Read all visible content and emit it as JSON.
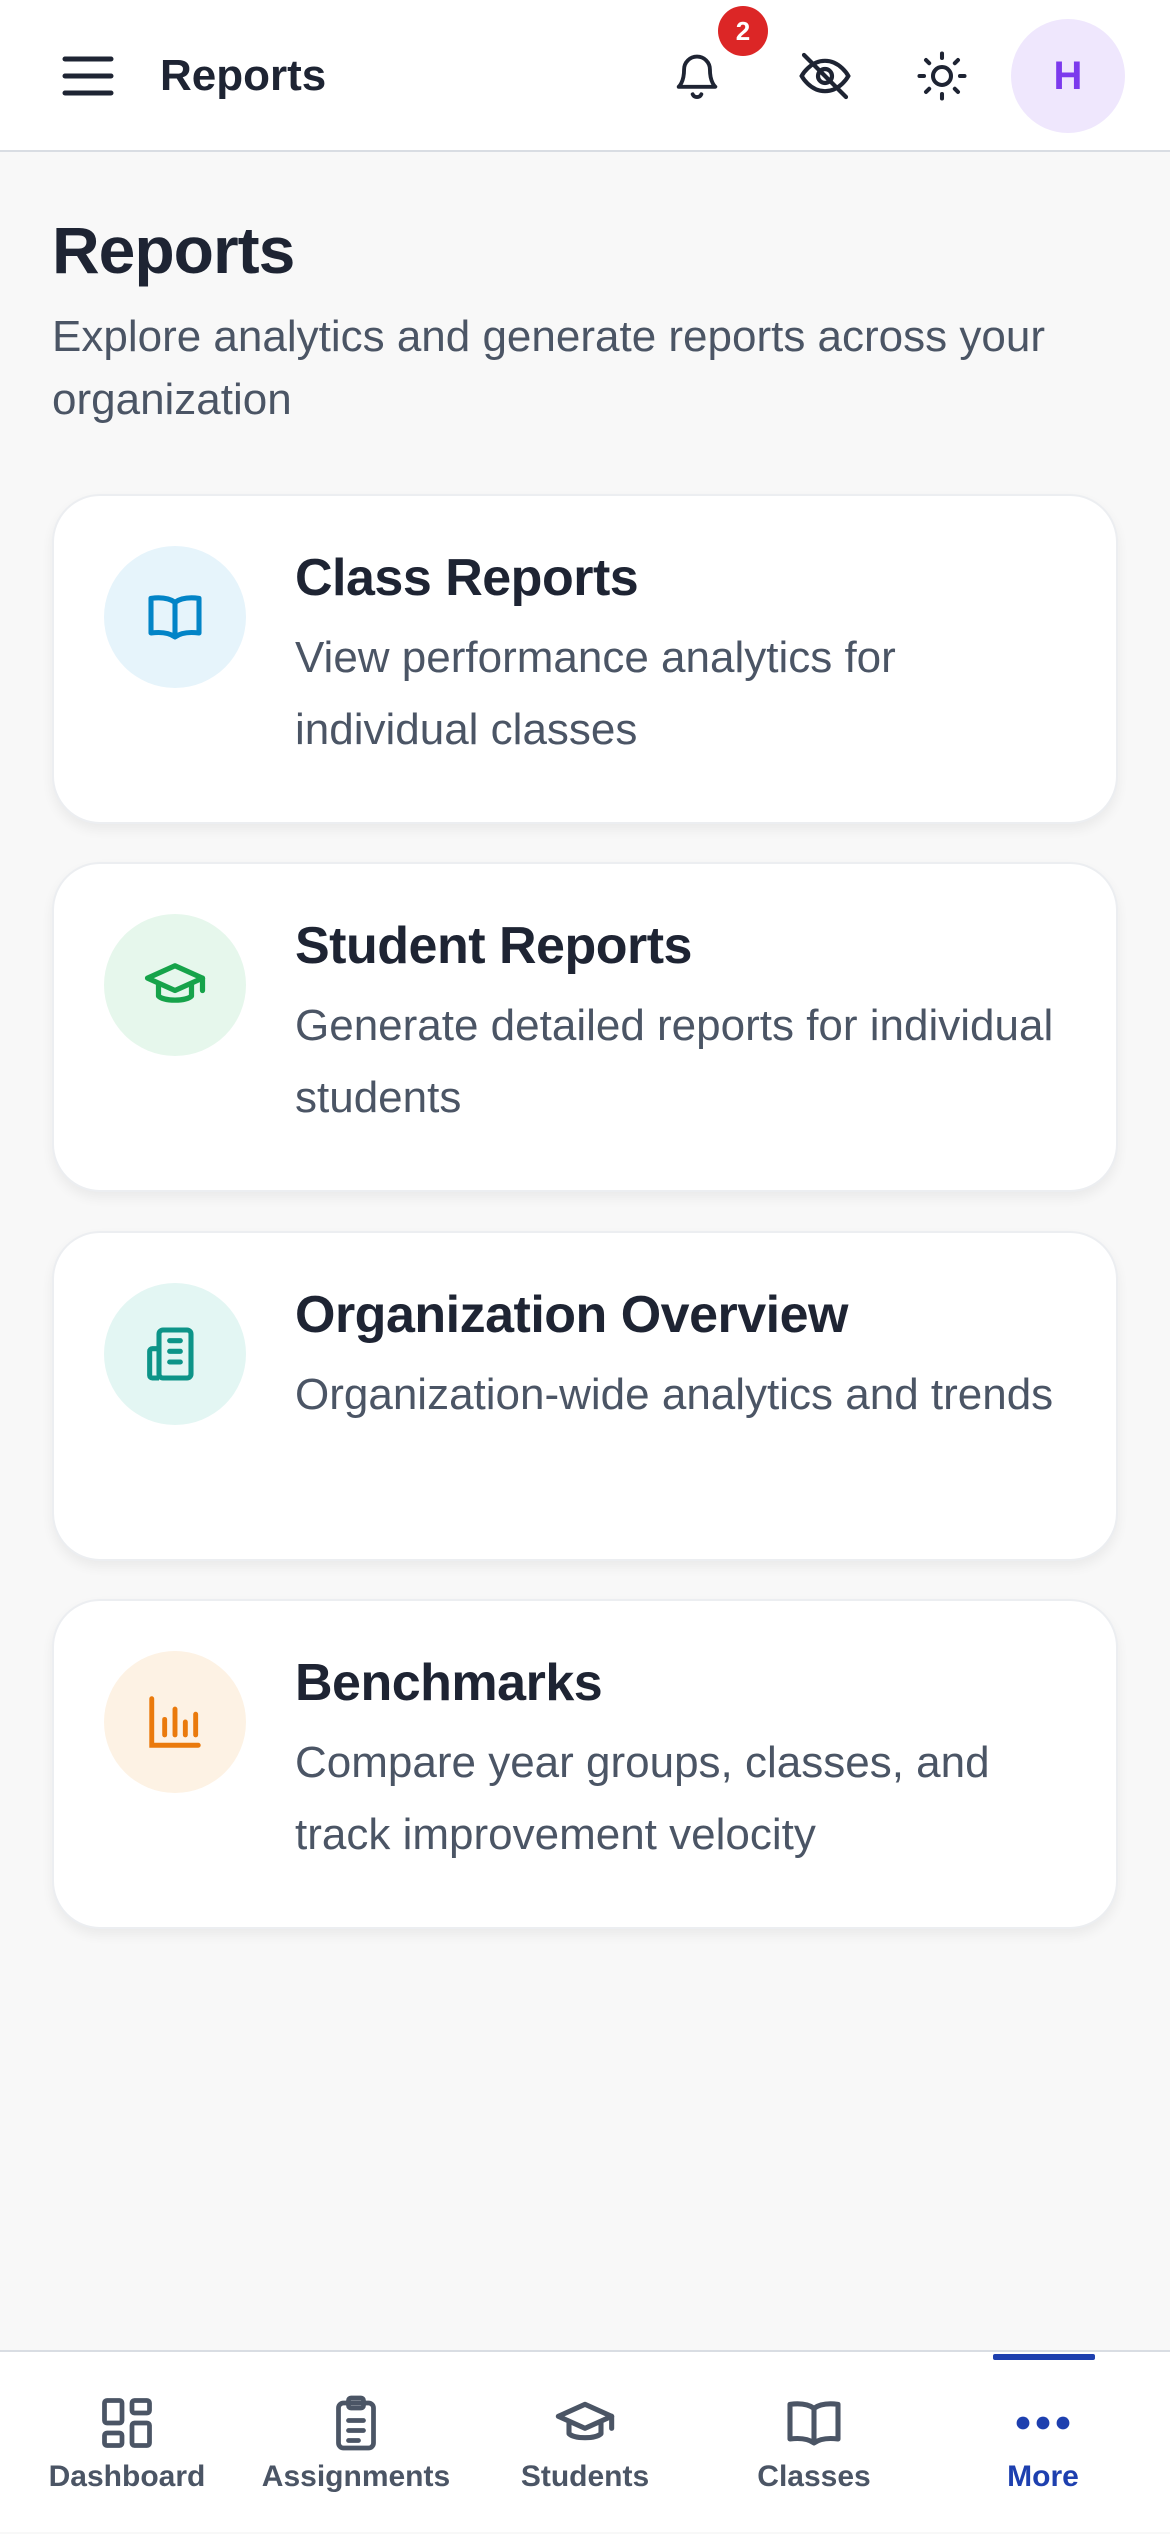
{
  "header": {
    "title": "Reports",
    "notification_count": "2",
    "avatar_initial": "H",
    "icons": [
      "menu-icon",
      "bell-icon",
      "eye-off-icon",
      "sun-icon"
    ]
  },
  "page": {
    "heading": "Reports",
    "subtitle": "Explore analytics and generate reports across your organization"
  },
  "cards": [
    {
      "title": "Class Reports",
      "description": "View performance analytics for individual classes",
      "icon": "book-open-icon",
      "accent": "#0284c7",
      "tint": "#e6f4fb"
    },
    {
      "title": "Student Reports",
      "description": "Generate detailed reports for individual students",
      "icon": "graduation-cap-icon",
      "accent": "#16a34a",
      "tint": "#e6f7ec"
    },
    {
      "title": "Organization Overview",
      "description": "Organization-wide analytics and trends",
      "icon": "building-icon",
      "accent": "#0d9488",
      "tint": "#e3f6f3"
    },
    {
      "title": "Benchmarks",
      "description": "Compare year groups, classes, and track improvement velocity",
      "icon": "bar-chart-icon",
      "accent": "#ea7a0c",
      "tint": "#fdf2e4"
    }
  ],
  "nav": {
    "items": [
      {
        "label": "Dashboard",
        "icon": "dashboard-icon"
      },
      {
        "label": "Assignments",
        "icon": "clipboard-icon"
      },
      {
        "label": "Students",
        "icon": "graduation-cap-icon"
      },
      {
        "label": "Classes",
        "icon": "book-open-icon"
      },
      {
        "label": "More",
        "icon": "more-dots-icon"
      }
    ],
    "active": "More"
  },
  "colors": {
    "accent": "#1e40af",
    "badge": "#dc2626",
    "avatar_bg": "#efe7fd",
    "avatar_text": "#7c3aed"
  }
}
